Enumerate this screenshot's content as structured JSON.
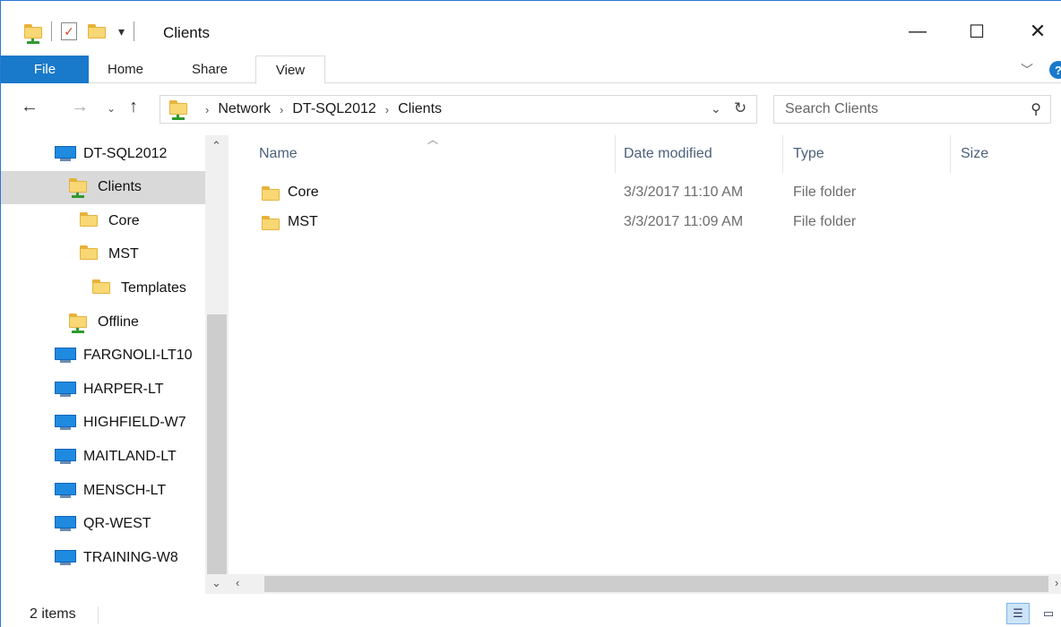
{
  "window": {
    "title": "Clients",
    "controls": {
      "minimize": "—",
      "maximize": "☐",
      "close": "✕"
    }
  },
  "ribbon": {
    "file": "File",
    "home": "Home",
    "share": "Share",
    "view": "View",
    "help": "?"
  },
  "address": {
    "crumbs": [
      "Network",
      "DT-SQL2012",
      "Clients"
    ],
    "separator": "›"
  },
  "search": {
    "placeholder": "Search Clients"
  },
  "nav_pane": {
    "items": [
      {
        "label": "DT-SQL2012",
        "icon": "computer-icon"
      },
      {
        "label": "Clients",
        "icon": "network-folder-icon",
        "selected": true
      },
      {
        "label": "Core",
        "icon": "folder-icon"
      },
      {
        "label": "MST",
        "icon": "folder-icon"
      },
      {
        "label": "Templates",
        "icon": "folder-icon"
      },
      {
        "label": "Offline",
        "icon": "network-folder-icon"
      },
      {
        "label": "FARGNOLI-LT10",
        "icon": "computer-icon"
      },
      {
        "label": "HARPER-LT",
        "icon": "computer-icon"
      },
      {
        "label": "HIGHFIELD-W7",
        "icon": "computer-icon"
      },
      {
        "label": "MAITLAND-LT",
        "icon": "computer-icon"
      },
      {
        "label": "MENSCH-LT",
        "icon": "computer-icon"
      },
      {
        "label": "QR-WEST",
        "icon": "computer-icon"
      },
      {
        "label": "TRAINING-W8",
        "icon": "computer-icon"
      }
    ]
  },
  "columns": {
    "name": "Name",
    "date": "Date modified",
    "type": "Type",
    "size": "Size"
  },
  "files": [
    {
      "name": "Core",
      "date": "3/3/2017 11:10 AM",
      "type": "File folder"
    },
    {
      "name": "MST",
      "date": "3/3/2017 11:09 AM",
      "type": "File folder"
    }
  ],
  "status": {
    "items": "2 items"
  },
  "colors": {
    "accent": "#1979ca",
    "selected": "#d9d9d9",
    "folder": "#f8d775"
  }
}
